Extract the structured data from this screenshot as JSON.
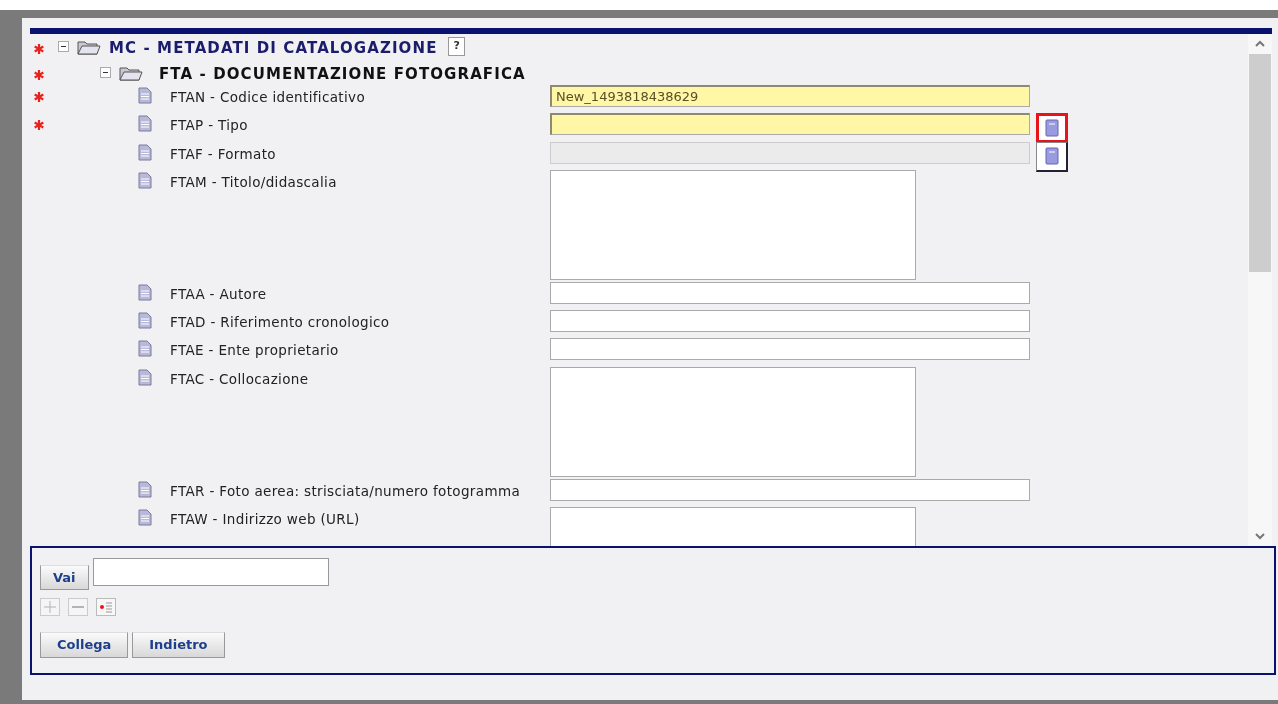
{
  "tree": {
    "label": "MC - METADATI DI CATALOGAZIONE",
    "required": true,
    "expanded": true,
    "help": "?",
    "children": [
      {
        "label": "FTA - DOCUMENTAZIONE FOTOGRAFICA",
        "required": true,
        "expanded": true,
        "fields": [
          {
            "kind": "text",
            "label": "FTAN - Codice identificativo",
            "required": true,
            "value": "New_1493818438629",
            "disabled": false
          },
          {
            "kind": "text",
            "label": "FTAP - Tipo",
            "required": true,
            "disabled": false,
            "lookup": true,
            "highlighted": true
          },
          {
            "kind": "text",
            "label": "FTAF - Formato",
            "required": false,
            "disabled": true,
            "lookup": true,
            "highlighted": false
          },
          {
            "kind": "textarea",
            "label": "FTAM - Titolo/didascalia",
            "required": false,
            "disabled": false
          },
          {
            "kind": "text",
            "label": "FTAA - Autore",
            "required": false,
            "disabled": false
          },
          {
            "kind": "text",
            "label": "FTAD - Riferimento cronologico",
            "required": false,
            "disabled": false
          },
          {
            "kind": "text",
            "label": "FTAE - Ente proprietario",
            "required": false,
            "disabled": false
          },
          {
            "kind": "textarea",
            "label": "FTAC - Collocazione",
            "required": false,
            "disabled": false
          },
          {
            "kind": "text",
            "label": "FTAR - Foto aerea: strisciata/numero fotogramma",
            "required": false,
            "disabled": false
          },
          {
            "kind": "textarea",
            "label": "FTAW - Indirizzo web (URL)",
            "required": false,
            "disabled": false
          }
        ]
      }
    ]
  },
  "goto": {
    "button": "Vai"
  },
  "tools": [
    {
      "kind": "add",
      "disabled": true
    },
    {
      "kind": "remove",
      "disabled": true
    },
    {
      "kind": "list",
      "disabled": false
    }
  ],
  "buttons": [
    "Collega",
    "Indietro"
  ]
}
